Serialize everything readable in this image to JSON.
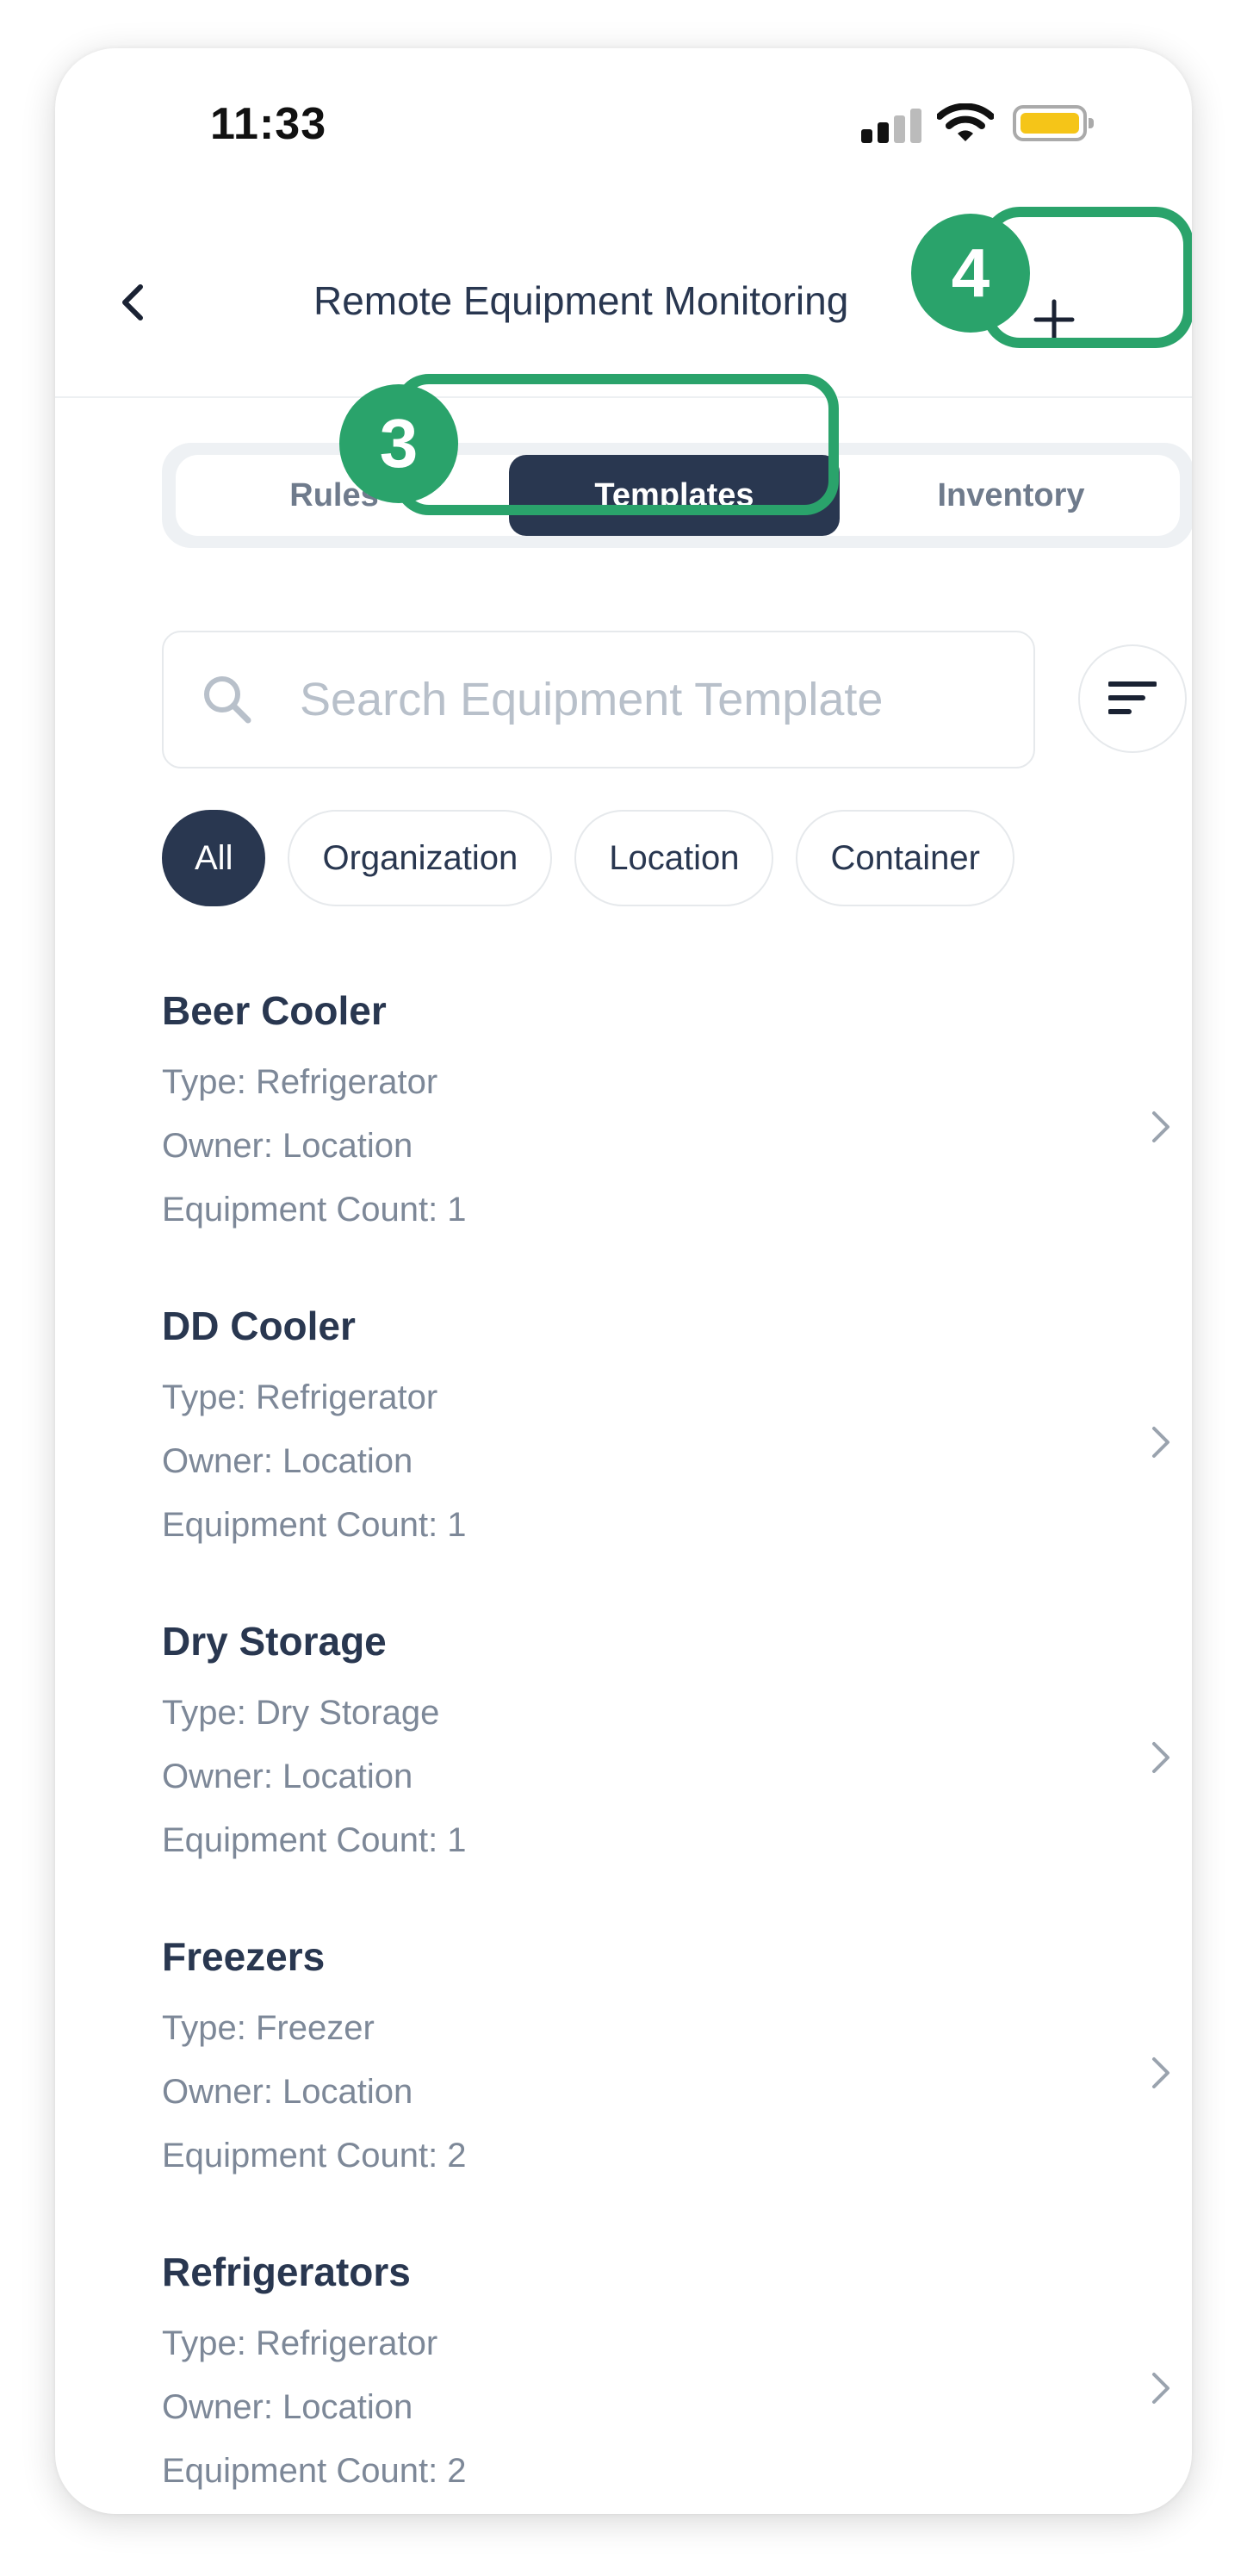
{
  "status_bar": {
    "time": "11:33"
  },
  "header": {
    "back_icon": "chevron-left-icon",
    "title": "Remote Equipment Monitoring",
    "add_label": "+"
  },
  "annotations": {
    "badge_3": "3",
    "badge_4": "4",
    "color": "#2aa36b"
  },
  "tabs": [
    {
      "label": "Rules",
      "active": false
    },
    {
      "label": "Templates",
      "active": true
    },
    {
      "label": "Inventory",
      "active": false
    }
  ],
  "search": {
    "placeholder": "Search Equipment Template",
    "value": ""
  },
  "filters": [
    {
      "label": "All",
      "active": true
    },
    {
      "label": "Organization",
      "active": false
    },
    {
      "label": "Location",
      "active": false
    },
    {
      "label": "Container",
      "active": false
    }
  ],
  "templates": [
    {
      "name": "Beer Cooler",
      "type": "Type: Refrigerator",
      "owner": "Owner: Location",
      "count": "Equipment Count: 1"
    },
    {
      "name": "DD Cooler",
      "type": "Type: Refrigerator",
      "owner": "Owner: Location",
      "count": "Equipment Count: 1"
    },
    {
      "name": "Dry Storage",
      "type": "Type: Dry Storage",
      "owner": "Owner: Location",
      "count": "Equipment Count: 1"
    },
    {
      "name": "Freezers",
      "type": "Type: Freezer",
      "owner": "Owner: Location",
      "count": "Equipment Count: 2"
    },
    {
      "name": "Refrigerators",
      "type": "Type: Refrigerator",
      "owner": "Owner: Location",
      "count": "Equipment Count: 2"
    }
  ],
  "colors": {
    "primary": "#293750",
    "highlight": "#2aa36b",
    "battery": "#f5c518"
  }
}
